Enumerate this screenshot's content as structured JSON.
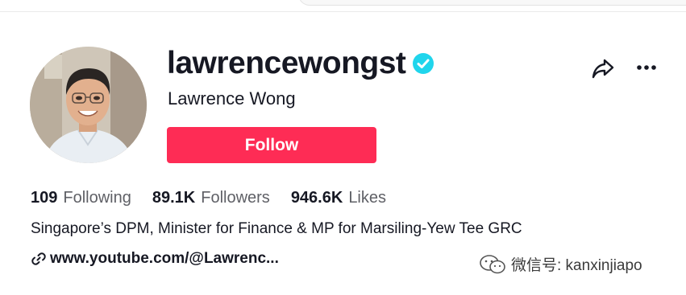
{
  "profile": {
    "username": "lawrencewongst",
    "display_name": "Lawrence Wong",
    "verified": true,
    "follow_label": "Follow",
    "bio": "Singapore’s DPM, Minister for Finance & MP for Marsiling-Yew Tee GRC",
    "link": "www.youtube.com/@Lawrenc..."
  },
  "stats": [
    {
      "value": "109",
      "label": "Following"
    },
    {
      "value": "89.1K",
      "label": "Followers"
    },
    {
      "value": "946.6K",
      "label": "Likes"
    }
  ],
  "watermark": {
    "text": "微信号: kanxinjiapo"
  },
  "icons": {
    "verified": "verified-badge-icon",
    "share": "share-arrow-icon",
    "more": "more-dots-icon",
    "link": "link-chain-icon",
    "watermark": "wechat-icon"
  },
  "colors": {
    "follow_button": "#fe2c55",
    "verified_badge": "#20d5ec",
    "text_primary": "#161823",
    "text_secondary": "#5f6066"
  }
}
